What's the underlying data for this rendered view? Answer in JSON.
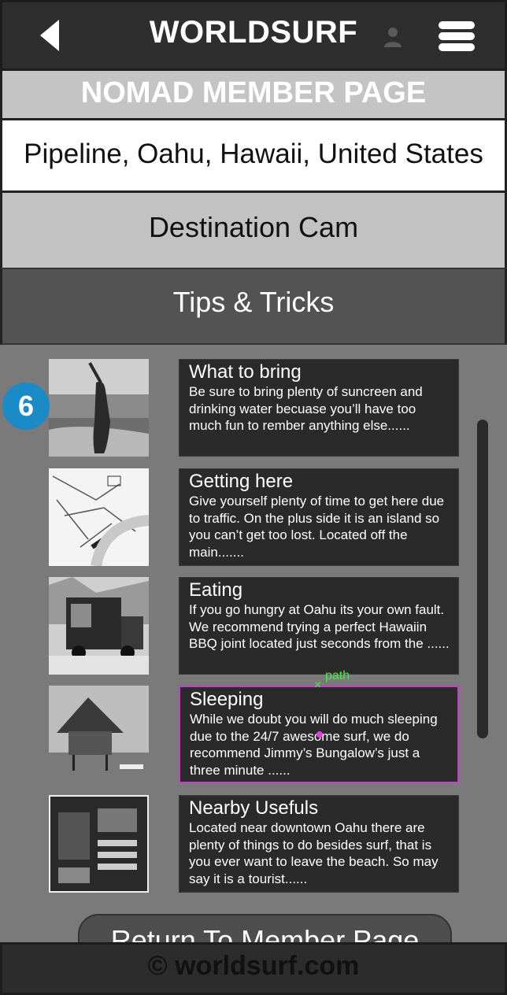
{
  "header": {
    "brand": "WORLDSURF",
    "icons": [
      "back-arrow-icon",
      "user-icon",
      "menu-icon"
    ]
  },
  "page_title": "NOMAD MEMBER PAGE",
  "location": "Pipeline, Oahu, Hawaii, United States",
  "destination_cam_label": "Destination Cam",
  "tips_label": "Tips & Tricks",
  "badge": "6",
  "tips": [
    {
      "title": "What to bring",
      "body": "Be sure to bring plenty of suncreen and drinking water becuase you’ll have too much fun to rember anything else......"
    },
    {
      "title": "Getting here",
      "body": "Give yourself plenty of time to get here due to traffic. On the plus side it is an island so you can’t get too lost. Located off the main......."
    },
    {
      "title": "Eating",
      "body": "If you go hungry at Oahu its your own fault. We recommend trying a perfect Hawaiin BBQ joint located just seconds from the ......"
    },
    {
      "title": "Sleeping",
      "body": "While we doubt you will do much sleeping due to the 24/7 awesome surf, we do recommend Jimmy’s Bungalow’s just a three minute ......"
    },
    {
      "title": "Nearby Usefuls",
      "body": "Located near downtown Oahu there are plenty of things to do besides surf, that is you ever want to leave the beach. So may say it is a tourist......"
    }
  ],
  "path_annotation": "path",
  "return_label": "Return To Member Page",
  "footer": "© worldsurf.com",
  "colors": {
    "header_bg": "#2e2e2e",
    "title_band": "#c4c4c4",
    "card_bg": "#2a2a2a",
    "badge": "#1b8bc7",
    "selection": "#c43ed0",
    "annotation": "#4ee34e"
  }
}
